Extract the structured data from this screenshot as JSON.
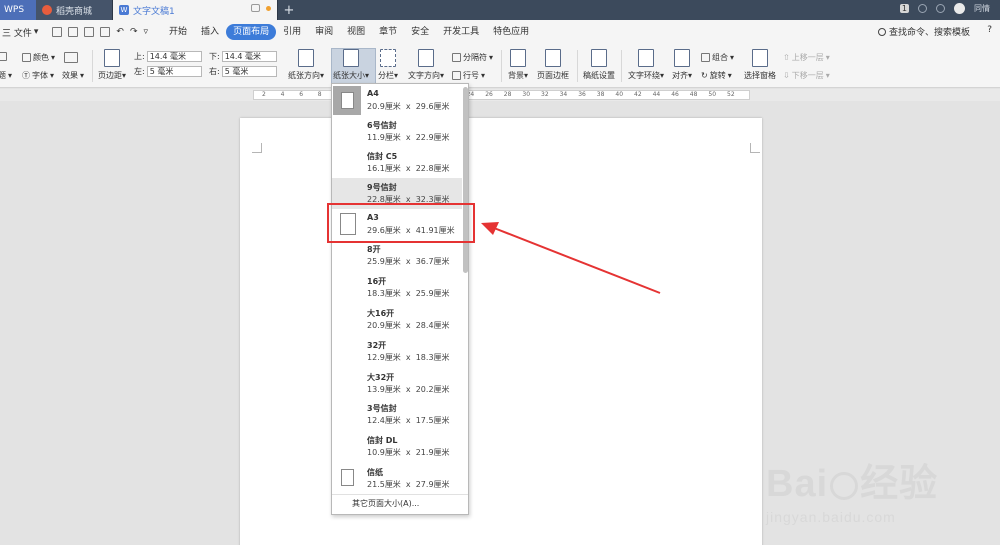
{
  "titlebar": {
    "app_name": "WPS",
    "tabs": [
      {
        "label": "稻壳商城"
      },
      {
        "label": "文字文稿1"
      }
    ],
    "page_badge": "1",
    "user": "同情"
  },
  "menubar": {
    "file": "三 文件",
    "items": [
      "开始",
      "插入",
      "页面布局",
      "引用",
      "审阅",
      "视图",
      "章节",
      "安全",
      "开发工具",
      "特色应用"
    ],
    "active": "页面布局",
    "search": "查找命令、搜索模板",
    "more": "?"
  },
  "ribbon": {
    "theme": "题",
    "colors": "颜色",
    "font": "字体",
    "effects": "效果",
    "margins": "页边距",
    "top_label": "上:",
    "top_value": "14.4 毫米",
    "bottom_label": "下:",
    "bottom_value": "14.4 毫米",
    "left_label": "左:",
    "left_value": "5 毫米",
    "right_label": "右:",
    "right_value": "5 毫米",
    "orientation": "纸张方向",
    "paper_size": "纸张大小",
    "columns": "分栏",
    "text_direction": "文字方向",
    "breaks": "分隔符",
    "line_numbers": "行号",
    "background": "背景",
    "page_border": "页面边框",
    "draft_paper": "稿纸设置",
    "text_wrap": "文字环绕",
    "align": "对齐",
    "group": "组合",
    "rotate": "旋转",
    "selection_pane": "选择窗格",
    "bring_forward": "上移一层",
    "send_backward": "下移一层"
  },
  "ruler": {
    "ticks": [
      "2",
      "4",
      "6",
      "8",
      "10",
      "12",
      "14",
      "16",
      "18",
      "20",
      "22",
      "24",
      "26",
      "28",
      "30",
      "32",
      "34",
      "36",
      "38",
      "40",
      "42",
      "44",
      "46",
      "48",
      "50",
      "52"
    ]
  },
  "paper_dropdown": {
    "items": [
      {
        "name": "A4",
        "size": "20.9厘米  x  29.6厘米"
      },
      {
        "name": "6号信封",
        "size": "11.9厘米  x  22.9厘米"
      },
      {
        "name": "信封 C5",
        "size": "16.1厘米  x  22.8厘米"
      },
      {
        "name": "9号信封",
        "size": "22.8厘米  x  32.3厘米"
      },
      {
        "name": "A3",
        "size": "29.6厘米  x  41.91厘米"
      },
      {
        "name": "8开",
        "size": "25.9厘米  x  36.7厘米"
      },
      {
        "name": "16开",
        "size": "18.3厘米  x  25.9厘米"
      },
      {
        "name": "大16开",
        "size": "20.9厘米  x  28.4厘米"
      },
      {
        "name": "32开",
        "size": "12.9厘米  x  18.3厘米"
      },
      {
        "name": "大32开",
        "size": "13.9厘米  x  20.2厘米"
      },
      {
        "name": "3号信封",
        "size": "12.4厘米  x  17.5厘米"
      },
      {
        "name": "信封 DL",
        "size": "10.9厘米  x  21.9厘米"
      },
      {
        "name": "信纸",
        "size": "21.5厘米  x  27.9厘米"
      }
    ],
    "footer": "其它页面大小(A)..."
  },
  "watermark": {
    "logo": "Bai经验",
    "url": "jingyan.baidu.com"
  },
  "colors": {
    "accent": "#3d7cd9",
    "highlight": "#e53333"
  }
}
